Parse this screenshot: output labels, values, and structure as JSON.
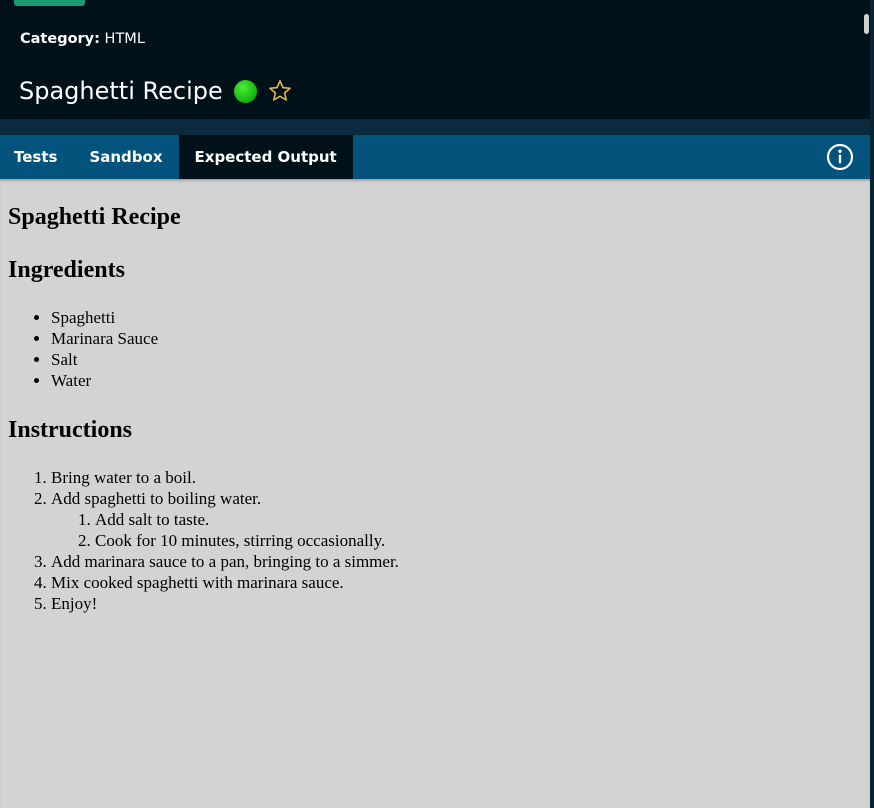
{
  "header": {
    "category_label": "Category:",
    "category_value": "HTML",
    "title": "Spaghetti Recipe",
    "status_icon": "green-status-dot",
    "favorite_icon": "star-outline-icon"
  },
  "tabs": [
    {
      "label": "Tests",
      "active": false
    },
    {
      "label": "Sandbox",
      "active": false
    },
    {
      "label": "Expected Output",
      "active": true
    }
  ],
  "info_icon": "info-icon",
  "output": {
    "heading": "Spaghetti Recipe",
    "ingredients_heading": "Ingredients",
    "ingredients": [
      "Spaghetti",
      "Marinara Sauce",
      "Salt",
      "Water"
    ],
    "instructions_heading": "Instructions",
    "instructions": [
      "Bring water to a boil.",
      "Add spaghetti to boiling water.",
      "Add marinara sauce to a pan, bringing to a simmer.",
      "Mix cooked spaghetti with marinara sauce.",
      "Enjoy!"
    ],
    "sub_instructions": [
      "Add salt to taste.",
      "Cook for 10 minutes, stirring occasionally."
    ]
  },
  "colors": {
    "header_bg": "#011119",
    "tabbar_bg": "#03537d",
    "content_bg": "#d3d3d3",
    "status_green": "#22c91a",
    "star_gold": "#e7b84a"
  }
}
